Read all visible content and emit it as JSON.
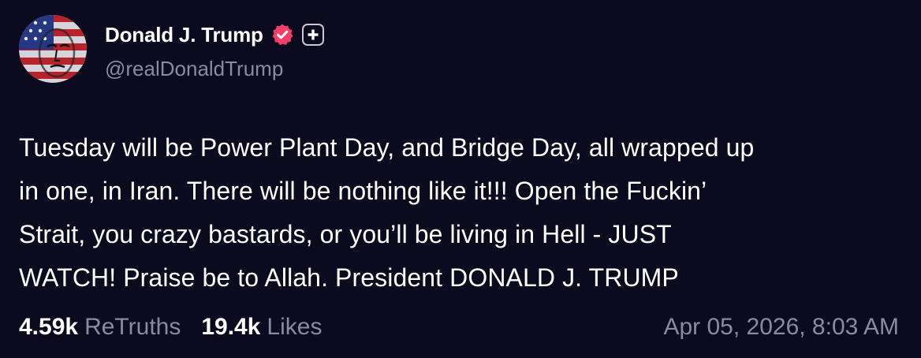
{
  "author": {
    "display_name": "Donald J. Trump",
    "handle": "@realDonaldTrump",
    "verified_icon": "verified-check-icon",
    "plus_icon": "plus-icon",
    "avatar": "flag-painted-portrait"
  },
  "post": {
    "lines": [
      "Tuesday will be Power Plant Day, and Bridge Day, all wrapped up",
      "in one, in Iran. There will be nothing like it!!! Open the Fuckin’",
      "Strait, you crazy bastards, or you’ll be living in Hell - JUST",
      "WATCH! Praise be to Allah. President DONALD J. TRUMP"
    ],
    "retruths_count": "4.59k",
    "retruths_label": "ReTruths",
    "likes_count": "19.4k",
    "likes_label": "Likes",
    "timestamp": "Apr 05, 2026, 8:03 AM"
  },
  "colors": {
    "background": "#0b0a1e",
    "text": "#ffffff",
    "muted": "#8b8a9e",
    "verified": "#f53f68"
  }
}
